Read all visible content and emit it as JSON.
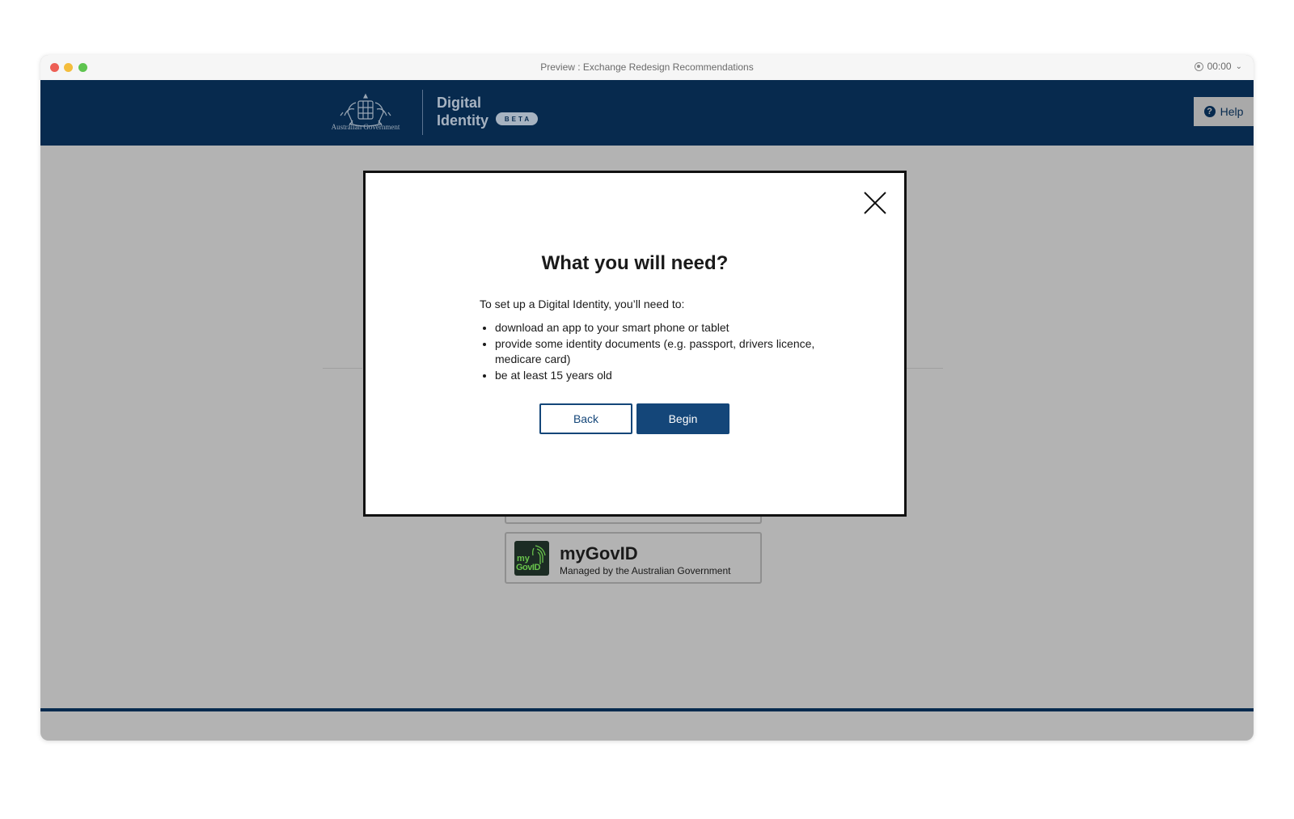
{
  "window": {
    "title": "Preview : Exchange Redesign Recommendations",
    "recorder_time": "00:00"
  },
  "header": {
    "gov_name": "Australian Government",
    "brand_line1": "Digital",
    "brand_line2": "Identity",
    "badge": "BETA",
    "help_label": "Help"
  },
  "provider_card": {
    "logo_line1": "my",
    "logo_line2": "GovID",
    "name": "myGovID",
    "subtitle": "Managed by the Australian Government"
  },
  "modal": {
    "title": "What you will need?",
    "intro": "To set up a Digital Identity, you’ll need to:",
    "requirements": [
      "download an app to your smart phone or tablet",
      "provide some identity documents (e.g. passport, drivers licence, medicare card)",
      "be at least 15 years old"
    ],
    "back_label": "Back",
    "begin_label": "Begin"
  },
  "colors": {
    "header_navy": "#072a4e",
    "button_blue": "#144679",
    "overlay_gray": "#b3b3b3",
    "logo_green": "#69c34c"
  }
}
